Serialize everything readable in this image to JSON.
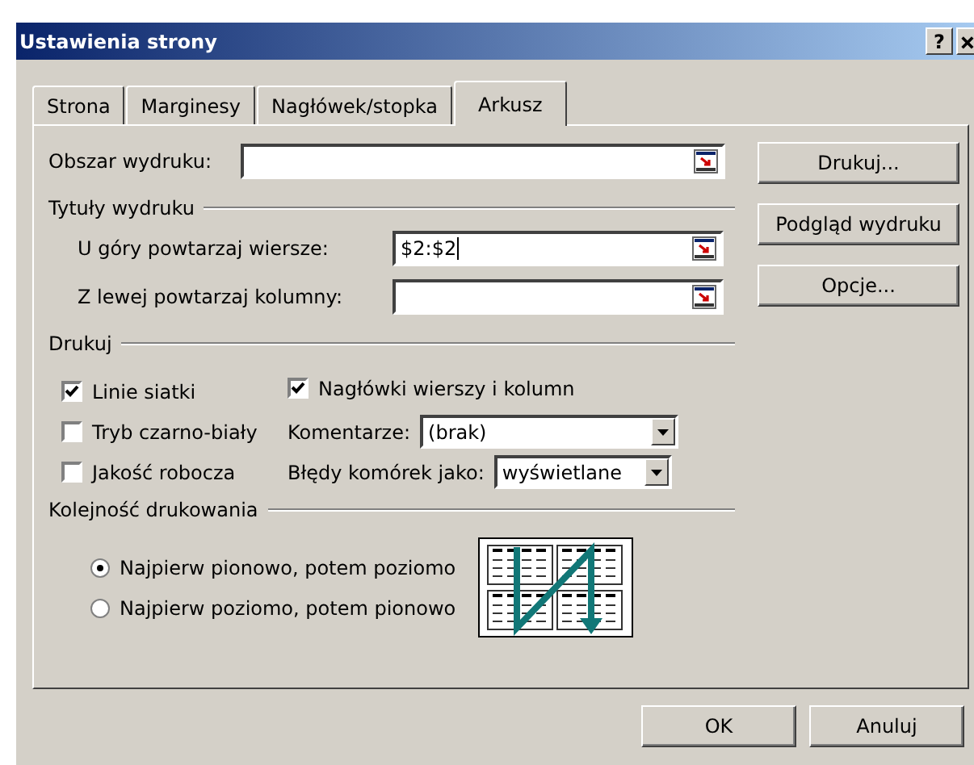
{
  "window": {
    "title": "Ustawienia strony",
    "help_button": "?"
  },
  "tabs": [
    {
      "label": "Strona",
      "selected": false
    },
    {
      "label": "Marginesy",
      "selected": false
    },
    {
      "label": "Nagłówek/stopka",
      "selected": false
    },
    {
      "label": "Arkusz",
      "selected": true
    }
  ],
  "print_area": {
    "label": "Obszar wydruku:"
  },
  "print_titles": {
    "heading": "Tytuły wydruku",
    "rows_field": {
      "label": "U góry powtarzaj wiersze:",
      "value": "$2:$2"
    },
    "columns_field": {
      "label": "Z lewej powtarzaj kolumny:"
    }
  },
  "print": {
    "heading": "Drukuj",
    "checkboxes": [
      {
        "label": "Linie siatki",
        "checked": true
      },
      {
        "label": "Tryb czarno-biały",
        "checked": false
      },
      {
        "label": "Jakość robocza",
        "checked": false
      }
    ],
    "headings_checkbox": {
      "label": "Nagłówki wierszy i kolumn",
      "checked": true
    },
    "comments": {
      "label": "Komentarze:",
      "value": "(brak)"
    },
    "cell_errors": {
      "label": "Błędy komórek jako:",
      "value": "wyświetlane"
    }
  },
  "page_order": {
    "heading": "Kolejność drukowania",
    "options": [
      {
        "label": "Najpierw pionowo, potem poziomo",
        "selected": true
      },
      {
        "label": "Najpierw poziomo, potem pionowo",
        "selected": false
      }
    ]
  },
  "side_buttons": [
    "Drukuj...",
    "Podgląd wydruku",
    "Opcje..."
  ],
  "footer_buttons": [
    "OK",
    "Anuluj"
  ]
}
